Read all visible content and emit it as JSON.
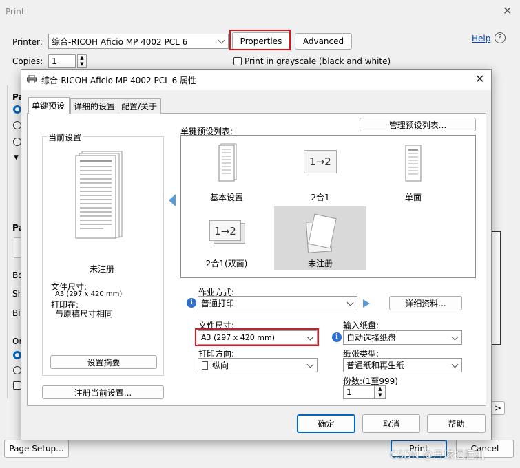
{
  "print_dialog": {
    "title": "Print",
    "printer_label": "Printer:",
    "printer_value": "综合-RICOH Aficio MP 4002 PCL 6",
    "properties_label": "Properties",
    "advanced_label": "Advanced",
    "help_label": "Help",
    "copies_label": "Copies:",
    "copies_value": "1",
    "grayscale_label": "Print in grayscale (black and white)",
    "page_setup_label": "Page Setup...",
    "print_label": "Print",
    "cancel_label": "Cancel",
    "left_fragments": [
      "Pa",
      "Pa",
      "Bo",
      "Sh",
      "Bi",
      "Or"
    ]
  },
  "props_dialog": {
    "title": "综合-RICOH Aficio MP 4002 PCL 6 属性",
    "tabs": [
      "单键预设",
      "详细的设置",
      "配置/关于"
    ],
    "current_settings": {
      "group_title": "当前设置",
      "preview_name": "未注册",
      "paper_size_label": "文件尺寸:",
      "paper_size_value": "A3 (297 x 420 mm)",
      "print_on_label": "打印在:",
      "print_on_value": "与原稿尺寸相同",
      "summary_button": "设置摘要",
      "register_button": "注册当前设置..."
    },
    "presets": {
      "label": "单键预设列表:",
      "manage_button": "管理预设列表...",
      "items": [
        {
          "name": "基本设置",
          "icon": "document-stack-icon"
        },
        {
          "name": "2合1",
          "icon": "two-in-one-icon"
        },
        {
          "name": "单面",
          "icon": "single-page-icon"
        },
        {
          "name": "2合1(双面)",
          "icon": "two-in-one-duplex-icon"
        },
        {
          "name": "未注册",
          "icon": "unregistered-page-icon"
        }
      ],
      "two_in_one_glyph": "1→2"
    },
    "job_type_label": "作业方式:",
    "job_type_value": "普通打印",
    "details_button": "详细资料...",
    "paper_size_label": "文件尺寸:",
    "paper_size_value": "A3 (297 x 420 mm)",
    "input_tray_label": "输入纸盘:",
    "input_tray_value": "自动选择纸盘",
    "orientation_label": "打印方向:",
    "orientation_value": "纵向",
    "paper_type_label": "纸张类型:",
    "paper_type_value": "普通纸和再生纸",
    "copies_label": "份数:(1至999)",
    "copies_value": "1",
    "ok_button": "确定",
    "cancel_button": "取消",
    "help_button": "帮助"
  },
  "watermark": "CSDN @月球挖掘机",
  "colors": {
    "accent": "#0067c0",
    "highlight_box": "#e0151b",
    "selected_preset": "#d9d9d9"
  }
}
